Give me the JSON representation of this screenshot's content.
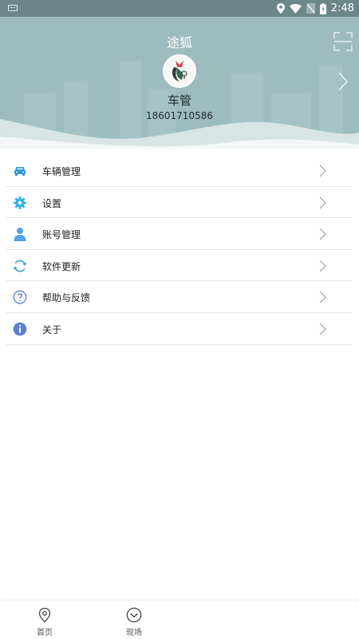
{
  "status_bar": {
    "time": "2:48",
    "icons": [
      "keyboard-icon",
      "location-icon",
      "wifi-icon",
      "no-sim-icon",
      "battery-icon"
    ]
  },
  "header": {
    "title": "途狐",
    "user_name": "车管",
    "phone": "18601710586",
    "bg_color": "#9cbcbd"
  },
  "menu": {
    "items": [
      {
        "label": "车辆管理",
        "icon": "car-icon",
        "color": "#2a9ad6"
      },
      {
        "label": "设置",
        "icon": "gear-icon",
        "color": "#3ab2e4"
      },
      {
        "label": "账号管理",
        "icon": "user-icon",
        "color": "#52a3e5"
      },
      {
        "label": "软件更新",
        "icon": "refresh-icon",
        "color": "#3aa3d6"
      },
      {
        "label": "帮助与反馈",
        "icon": "help-icon",
        "color": "#5b7fd6"
      },
      {
        "label": "关于",
        "icon": "info-icon",
        "color": "#5b7fd6"
      }
    ]
  },
  "bottom_nav": {
    "items": [
      {
        "label": "首页",
        "icon": "location-pin-icon"
      },
      {
        "label": "现场",
        "icon": "chevron-circle-icon"
      }
    ]
  }
}
